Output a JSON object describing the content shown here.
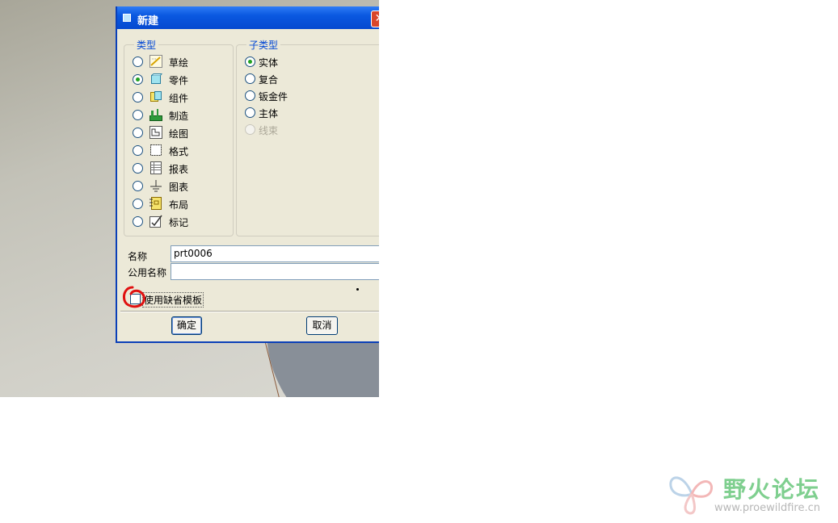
{
  "dialog": {
    "title": "新建",
    "close_label": "✕",
    "type_group": {
      "label": "类型",
      "items": [
        {
          "label": "草绘",
          "icon": "sketch-icon",
          "selected": false
        },
        {
          "label": "零件",
          "icon": "part-icon",
          "selected": true
        },
        {
          "label": "组件",
          "icon": "assembly-icon",
          "selected": false
        },
        {
          "label": "制造",
          "icon": "manufacturing-icon",
          "selected": false
        },
        {
          "label": "绘图",
          "icon": "drawing-icon",
          "selected": false
        },
        {
          "label": "格式",
          "icon": "format-icon",
          "selected": false
        },
        {
          "label": "报表",
          "icon": "report-icon",
          "selected": false
        },
        {
          "label": "图表",
          "icon": "diagram-icon",
          "selected": false
        },
        {
          "label": "布局",
          "icon": "layout-icon",
          "selected": false
        },
        {
          "label": "标记",
          "icon": "markup-icon",
          "selected": false
        }
      ]
    },
    "subtype_group": {
      "label": "子类型",
      "items": [
        {
          "label": "实体",
          "selected": true,
          "disabled": false
        },
        {
          "label": "复合",
          "selected": false,
          "disabled": false
        },
        {
          "label": "钣金件",
          "selected": false,
          "disabled": false
        },
        {
          "label": "主体",
          "selected": false,
          "disabled": false
        },
        {
          "label": "线束",
          "selected": false,
          "disabled": true
        }
      ]
    },
    "name_label": "名称",
    "name_value": "prt0006",
    "common_name_label": "公用名称",
    "common_name_value": "",
    "default_template_label": "使用缺省模板",
    "default_template_checked": false,
    "ok_label": "确定",
    "cancel_label": "取消"
  },
  "watermark": {
    "title": "野火论坛",
    "url": "www.proewildfire.cn"
  },
  "colors": {
    "titlebar": "#0a58e0",
    "dialog_bg": "#ece9d8",
    "group_label": "#0046d5",
    "annotation_red": "#e01010"
  }
}
